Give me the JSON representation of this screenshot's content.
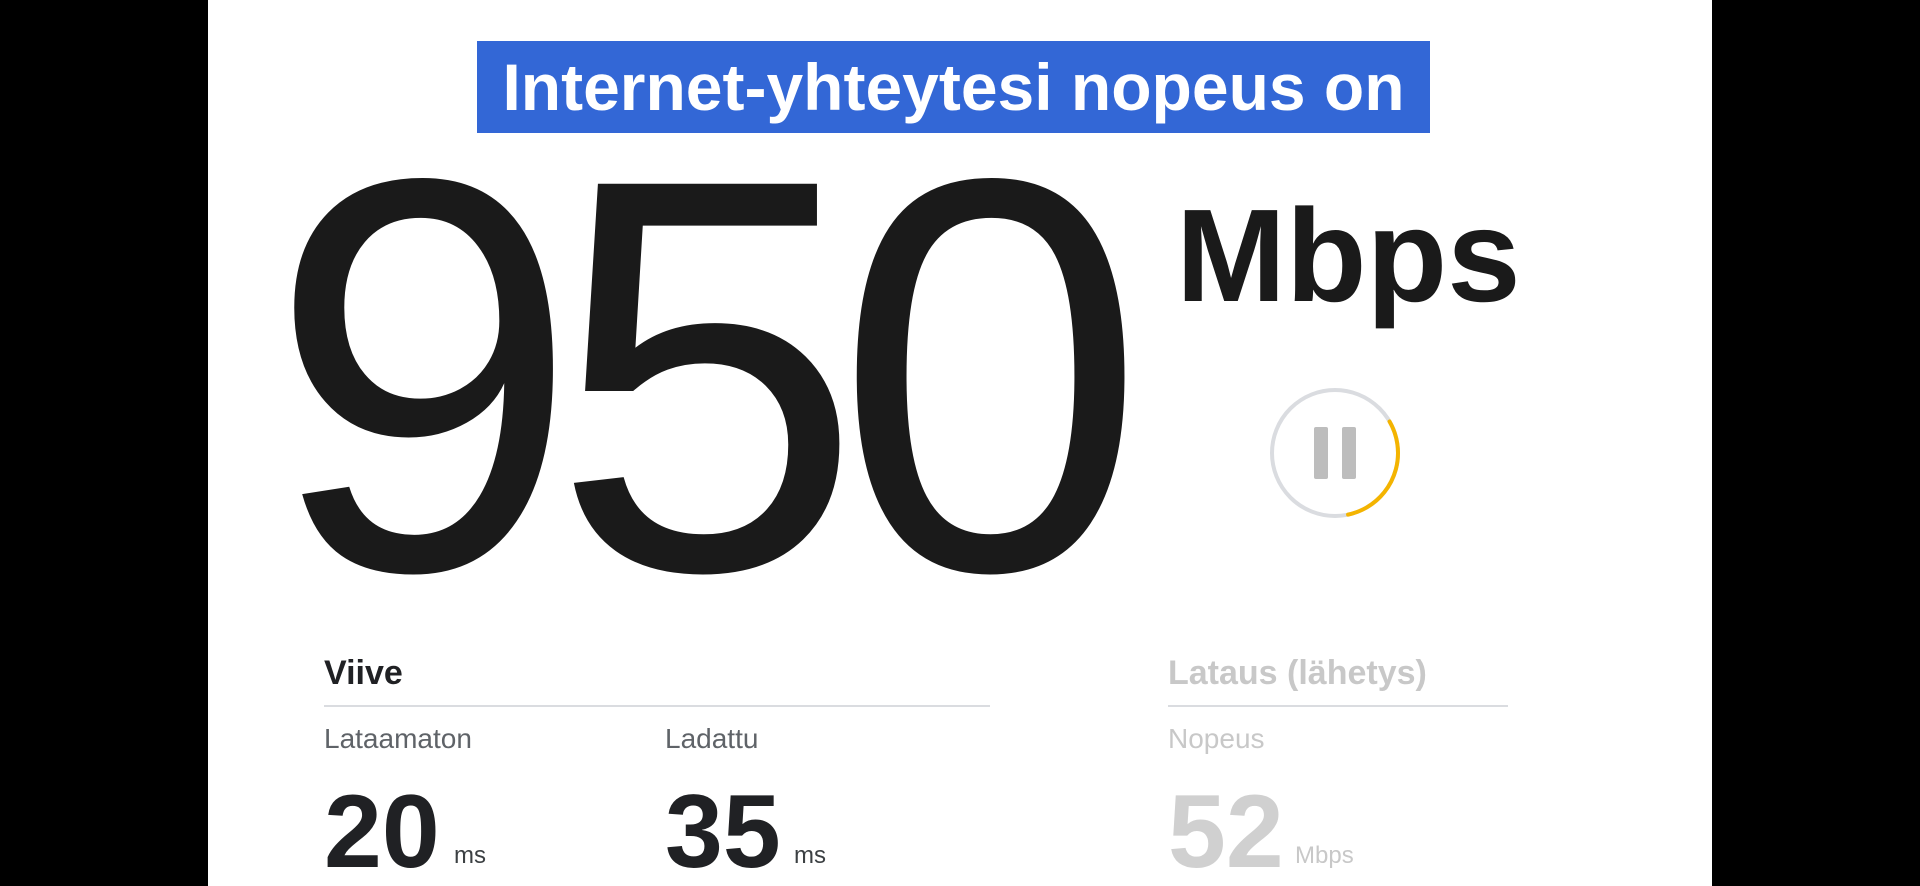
{
  "header": {
    "title": "Internet-yhteytesi nopeus on"
  },
  "result": {
    "speed_value": "950",
    "speed_unit": "Mbps"
  },
  "controls": {
    "pause_icon": "pause-icon",
    "progress": 0.3,
    "progress_color": "#f4b400"
  },
  "latency": {
    "heading": "Viive",
    "unloaded": {
      "label": "Lataamaton",
      "value": "20",
      "unit": "ms"
    },
    "loaded": {
      "label": "Ladattu",
      "value": "35",
      "unit": "ms"
    }
  },
  "upload": {
    "heading": "Lataus (lähetys)",
    "speed": {
      "label": "Nopeus",
      "value": "52",
      "unit": "Mbps"
    }
  },
  "colors": {
    "title_background": "#3367d6",
    "title_text": "#ffffff",
    "dimmed_text": "#c8c8c8"
  }
}
